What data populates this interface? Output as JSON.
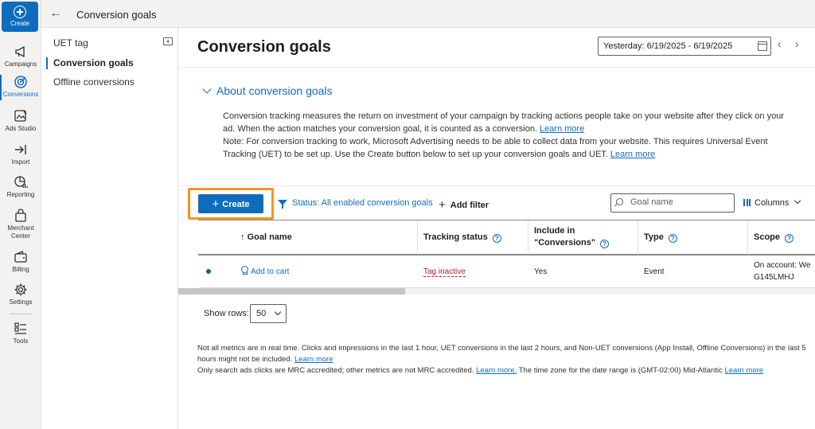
{
  "rail": {
    "create": "Create",
    "items": [
      {
        "label": "Campaigns"
      },
      {
        "label": "Conversions"
      },
      {
        "label": "Ads Studio"
      },
      {
        "label": "Import"
      },
      {
        "label": "Reporting"
      },
      {
        "label": "Merchant Center"
      },
      {
        "label": "Billing"
      },
      {
        "label": "Settings"
      },
      {
        "label": "Tools"
      }
    ]
  },
  "topbar": {
    "title": "Conversion goals"
  },
  "sidebar": {
    "items": [
      {
        "label": "UET tag"
      },
      {
        "label": "Conversion goals"
      },
      {
        "label": "Offline conversions"
      }
    ]
  },
  "main": {
    "title": "Conversion goals",
    "date_range": "Yesterday: 6/19/2025 - 6/19/2025",
    "about": {
      "heading": "About conversion goals",
      "p1": "Conversion tracking measures the return on investment of your campaign by tracking actions people take on your website after they click on your ad. When the action matches your conversion goal, it is counted as a conversion.",
      "p1_link": "Learn more",
      "p2": "Note: For conversion tracking to work, Microsoft Advertising needs to be able to collect data from your website. This requires Universal Event Tracking (UET) to be set up. Use the Create button below to set up your conversion goals and UET.",
      "p2_link": "Learn more"
    },
    "toolbar": {
      "create": "Create",
      "status_filter": "Status: All enabled conversion goals",
      "add_filter": "Add filter",
      "search_placeholder": "Goal name",
      "columns": "Columns"
    },
    "table": {
      "headers": {
        "goal_name": "Goal name",
        "tracking_status": "Tracking status",
        "include_line1": "Include in",
        "include_line2": "\"Conversions\"",
        "type": "Type",
        "scope": "Scope"
      },
      "rows": [
        {
          "goal_name": "Add to cart",
          "tracking_status": "Tag inactive",
          "include": "Yes",
          "type": "Event",
          "scope_line1": "On account: We",
          "scope_line2": "G145LMHJ"
        }
      ]
    },
    "pagination": {
      "label": "Show rows:",
      "value": "50"
    },
    "footnote": {
      "line1": "Not all metrics are in real time. Clicks and impressions in the last 1 hour, UET conversions in the last 2 hours, and Non-UET conversions (App Install, Offline Conversions) in the last 5 hours might not be included.",
      "line1_link": "Learn more",
      "line2": "Only search ads clicks are MRC accredited; other metrics are not MRC accredited.",
      "line2_link": "Learn more.",
      "line2_b": "The time zone for the date range is (GMT-02:00) Mid-Atlantic",
      "line2_link2": "Learn more"
    }
  }
}
